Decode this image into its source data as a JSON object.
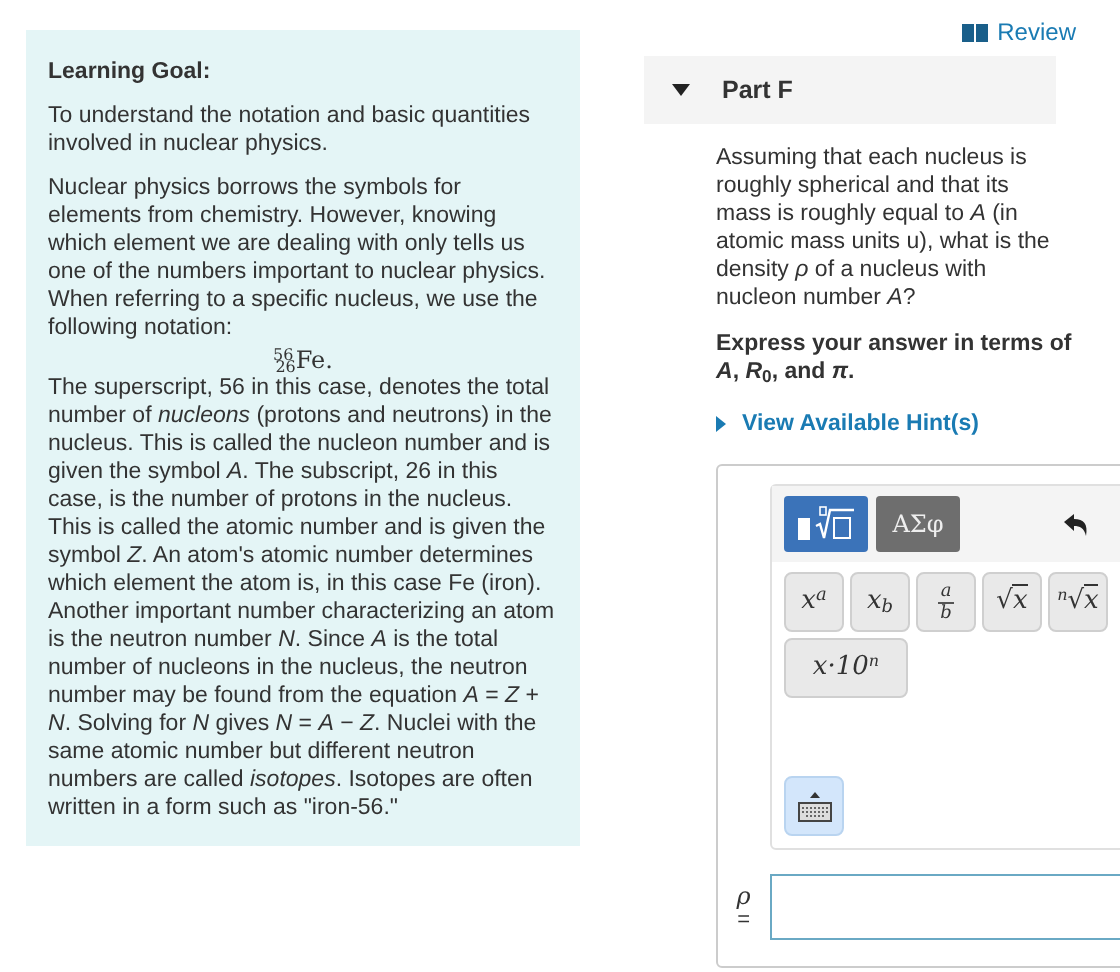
{
  "learning_goal": {
    "title": "Learning Goal:",
    "paragraphs": [
      "To understand the notation and basic quantities involved in nuclear physics.",
      "Nuclear physics borrows the symbols for elements from chemistry. However, knowing which element we are dealing with only tells us one of the numbers important to nuclear physics. When referring to a specific nucleus, we use the following notation:"
    ],
    "notation": "$^{56}$$_{26}$Fe.",
    "body": "The superscript, 56 in this case, denotes the total number of *nucleons* (protons and neutrons) in the nucleus. This is called the nucleon number and is given the symbol *A*. The subscript, 26 in this case, is the number of protons in the nucleus. This is called the atomic number and is given the symbol *Z*. An atom's atomic number determines which element the atom is, in this case Fe (iron). Another important number characterizing an atom is the neutron number *N*. Since *A* is the total number of nucleons in the nucleus, the neutron number may be found from the equation *A* = *Z* + *N*. Solving for *N* gives *N* = *A* − *Z*. Nuclei with the same atomic number but different neutron numbers are called *isotopes*. Isotopes are often written in a form such as \"iron-56.\""
  },
  "review_link": "Review",
  "part": {
    "title": "Part F",
    "expanded": true,
    "question": "Assuming that each nucleus is roughly spherical and that its mass is roughly equal to *A* (in atomic mass units u), what is the density *ρ* of a nucleus with nucleon number *A*?",
    "instruction": "Express your answer in terms of *A*, *R*$_{0}$, and *π*.",
    "hints_link": "View Available Hint(s)"
  },
  "editor": {
    "tabs": [
      {
        "kind": "templates",
        "selected": true
      },
      {
        "kind": "symbols",
        "label": "ΑΣφ",
        "selected": false
      }
    ],
    "buttons": [
      {
        "kind": "sup",
        "base": "x",
        "script": "a"
      },
      {
        "kind": "sub",
        "base": "x",
        "script": "b"
      },
      {
        "kind": "frac",
        "num": "a",
        "den": "b"
      },
      {
        "kind": "root",
        "sign": "√",
        "radicand": "x"
      },
      {
        "kind": "nroot",
        "index": "n",
        "sign": "√",
        "radicand": "x"
      },
      {
        "kind": "sci",
        "base": "x·10",
        "script": "n"
      }
    ],
    "keyboard_toggle": {
      "selected": true
    },
    "answer_label": "ρ",
    "equals": "="
  }
}
